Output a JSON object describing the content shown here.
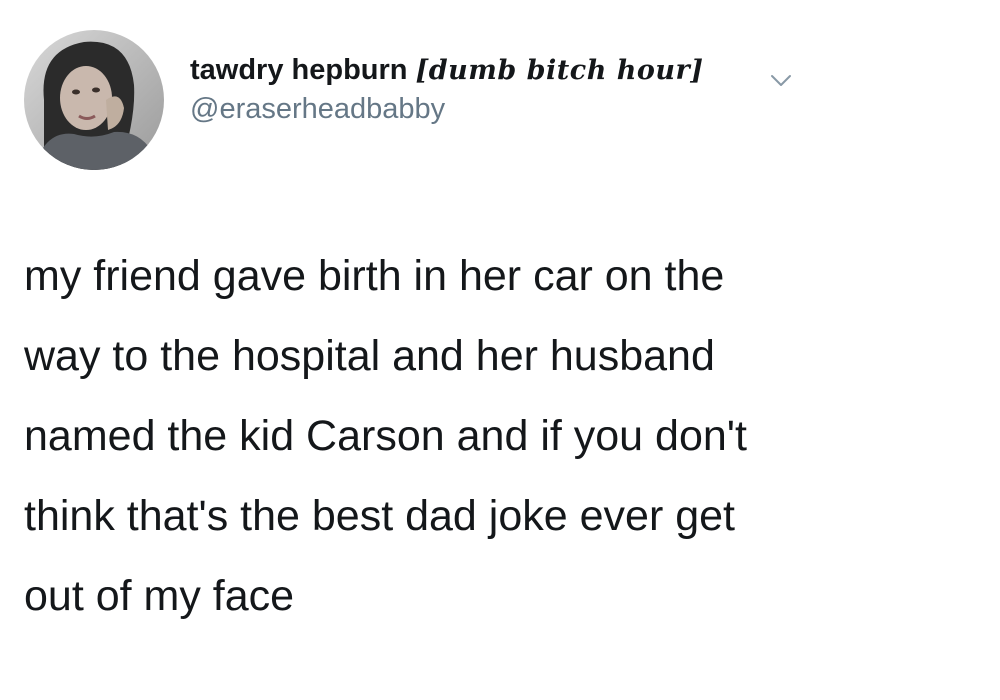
{
  "tweet": {
    "display_name": "tawdry hepburn",
    "name_decoration": "[dumb bitch hour]",
    "handle": "@eraserheadbabby",
    "caret_icon": "chevron-down-icon",
    "avatar_icon": "profile-photo",
    "body_lines": [
      "my friend gave birth in her car on the",
      "way to the hospital and her husband",
      "named the kid Carson and if you don't",
      "think that's the best dad joke ever get",
      "out of my face"
    ]
  },
  "colors": {
    "text_primary": "#14171a",
    "text_secondary": "#657786",
    "background": "#ffffff"
  }
}
